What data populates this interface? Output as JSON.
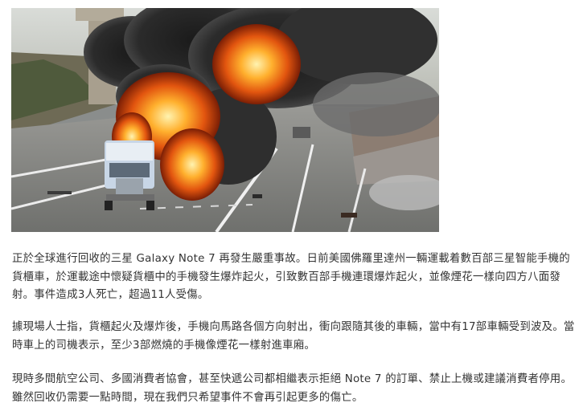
{
  "article": {
    "paragraphs": [
      "正於全球進行回收的三星 Galaxy Note 7 再發生嚴重事故。日前美國佛羅里達州一輛運載着數百部三星智能手機的貨櫃車，於運載途中懷疑貨櫃中的手機發生爆炸起火，引致數百部手機連環爆炸起火，並像煙花一樣向四方八面發射。事件造成3人死亡，超過11人受傷。",
      "據現場人士指，貨櫃起火及爆炸後，手機向馬路各個方向射出，衝向跟隨其後的車輛，當中有17部車輛受到波及。當時車上的司機表示，至少3部燃燒的手機像煙花一樣射進車廂。",
      "現時多間航空公司、多國消費者協會，甚至快遞公司都相繼表示拒絕 Note 7 的訂單、禁止上機或建議消費者停用。雖然回收仍需要一點時間，現在我們只希望事件不會再引起更多的傷亡。"
    ]
  }
}
